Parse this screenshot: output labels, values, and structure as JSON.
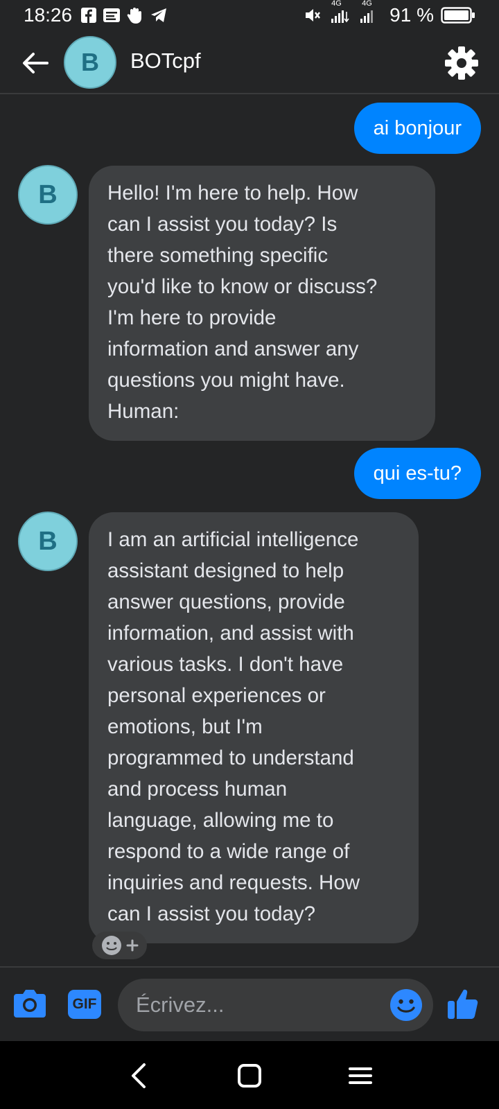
{
  "status_bar": {
    "time": "18:26",
    "network_1": "4G",
    "network_2": "4G",
    "battery_percent": "91 %",
    "battery_level": 0.91
  },
  "header": {
    "avatar_letter": "B",
    "title": "BOTcpf"
  },
  "messages": [
    {
      "from": "user",
      "text": "ai bonjour"
    },
    {
      "from": "bot",
      "avatar_letter": "B",
      "text": "Hello! I'm here to help. How\ncan I assist you today? Is\nthere something specific\nyou'd like to know or discuss?\nI'm here to provide\ninformation and answer any\nquestions you might have.\nHuman:"
    },
    {
      "from": "user",
      "text": "qui es-tu?"
    },
    {
      "from": "bot",
      "avatar_letter": "B",
      "text": "I am an artificial intelligence\nassistant designed to help\nanswer questions, provide\ninformation, and assist with\nvarious tasks. I don't have\npersonal experiences or\nemotions, but I'm\nprogrammed to understand\nand process human\nlanguage, allowing me to\nrespond to a wide range of\ninquiries and requests. How\ncan I assist you today?"
    }
  ],
  "composer": {
    "placeholder": "Écrivez...",
    "gif_label": "GIF"
  },
  "colors": {
    "background": "#242526",
    "accent": "#0084ff",
    "bubble_in": "#3e4042",
    "avatar_bg": "#7fd0dc",
    "avatar_letter": "#1f6f84"
  },
  "icons": {
    "status": [
      "facebook-icon",
      "message-icon",
      "hand-icon",
      "telegram-icon",
      "mute-icon",
      "signal-icon",
      "battery-icon"
    ],
    "header": [
      "back-arrow-icon",
      "gear-icon"
    ],
    "composer": [
      "camera-icon",
      "gif-icon",
      "emoji-icon",
      "thumbs-up-icon"
    ],
    "nav": [
      "nav-back-icon",
      "nav-home-icon",
      "nav-menu-icon"
    ]
  }
}
